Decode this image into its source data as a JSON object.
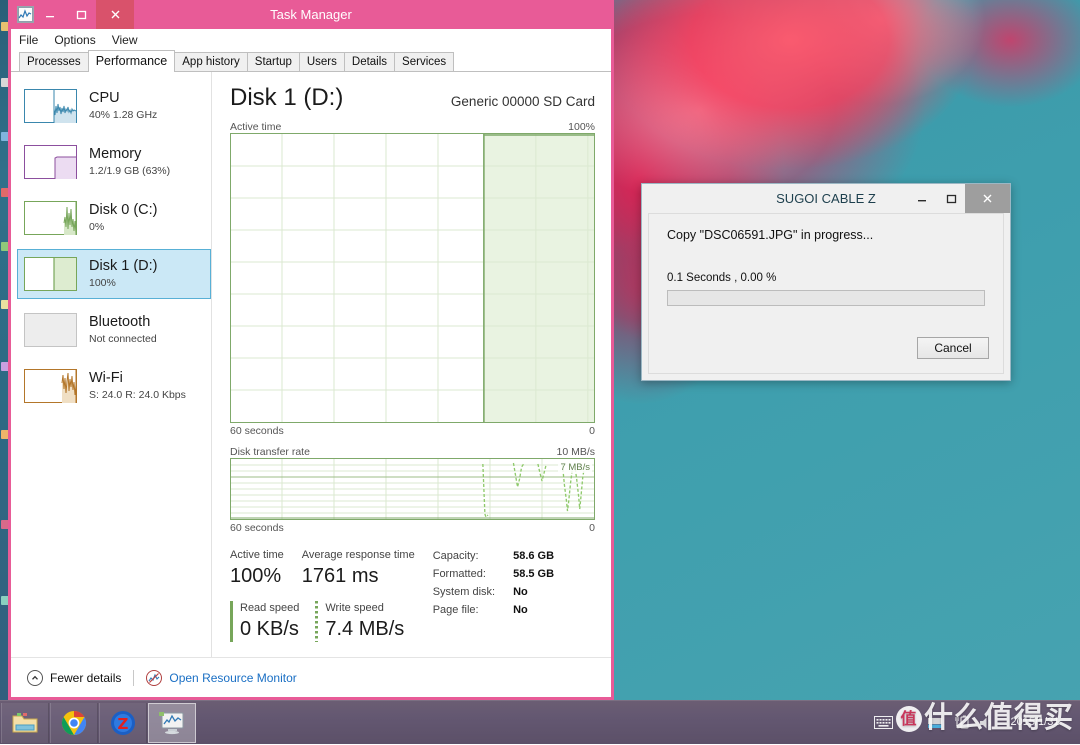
{
  "taskmanager": {
    "title": "Task Manager",
    "app_icon": "chart-icon",
    "window_buttons": {
      "minimize": "minimize-icon",
      "maximize": "maximize-icon",
      "close": "close-icon"
    },
    "menu": [
      "File",
      "Options",
      "View"
    ],
    "tabs": [
      {
        "label": "Processes",
        "active": false
      },
      {
        "label": "Performance",
        "active": true
      },
      {
        "label": "App history",
        "active": false
      },
      {
        "label": "Startup",
        "active": false
      },
      {
        "label": "Users",
        "active": false
      },
      {
        "label": "Details",
        "active": false
      },
      {
        "label": "Services",
        "active": false
      }
    ],
    "sidebar": {
      "items": [
        {
          "name": "CPU",
          "sub": "40%  1.28 GHz",
          "color": "#3a87ad",
          "selected": false
        },
        {
          "name": "Memory",
          "sub": "1.2/1.9 GB (63%)",
          "color": "#8c4f9e",
          "selected": false
        },
        {
          "name": "Disk 0 (C:)",
          "sub": "0%",
          "color": "#77a65a",
          "selected": false
        },
        {
          "name": "Disk 1 (D:)",
          "sub": "100%",
          "color": "#77a65a",
          "selected": true
        },
        {
          "name": "Bluetooth",
          "sub": "Not connected",
          "color": "#bdbdbd",
          "selected": false
        },
        {
          "name": "Wi-Fi",
          "sub": "S: 24.0 R: 24.0 Kbps",
          "color": "#b3762a",
          "selected": false
        }
      ]
    },
    "main": {
      "title": "Disk 1 (D:)",
      "device": "Generic 00000 SD Card",
      "active_graph": {
        "caption": "Active time",
        "max_label": "100%",
        "left_foot": "60 seconds",
        "right_foot": "0"
      },
      "rate_graph": {
        "caption": "Disk transfer rate",
        "max_label": "10 MB/s",
        "peak_label": "7 MB/s",
        "left_foot": "60 seconds",
        "right_foot": "0"
      },
      "stats": {
        "active_time_label": "Active time",
        "active_time_value": "100%",
        "avg_response_label": "Average response time",
        "avg_response_value": "1761 ms",
        "read_label": "Read speed",
        "read_value": "0 KB/s",
        "write_label": "Write speed",
        "write_value": "7.4 MB/s"
      },
      "properties": [
        {
          "key": "Capacity:",
          "value": "58.6 GB"
        },
        {
          "key": "Formatted:",
          "value": "58.5 GB"
        },
        {
          "key": "System disk:",
          "value": "No"
        },
        {
          "key": "Page file:",
          "value": "No"
        }
      ]
    },
    "footer": {
      "fewer_details": "Fewer details",
      "fewer_details_icon": "chevron-up-circle-icon",
      "resource_monitor": "Open Resource Monitor",
      "resource_monitor_icon": "resource-monitor-icon"
    },
    "accent_color": "#e85b97",
    "close_color": "#d9526b"
  },
  "sugoi_dialog": {
    "title": "SUGOI CABLE Z",
    "message": "Copy \"DSC06591.JPG\" in progress...",
    "status": "0.1 Seconds , 0.00 %",
    "progress_percent": 0,
    "cancel_label": "Cancel",
    "window_buttons": {
      "minimize": "minimize-icon",
      "maximize": "maximize-icon",
      "close": "close-icon"
    }
  },
  "taskbar": {
    "buttons": [
      {
        "name": "file-explorer",
        "active": false
      },
      {
        "name": "chrome",
        "active": false
      },
      {
        "name": "sugoi-cable-z",
        "active": false
      },
      {
        "name": "task-manager",
        "active": true
      }
    ],
    "tray_icons": [
      "keyboard-icon",
      "show-hidden-icons-chevron",
      "network-icon",
      "battery-icon",
      "volume-icon"
    ],
    "clock_date": "2015/1/31"
  },
  "watermark": {
    "badge": "值",
    "text": "什么值得买"
  }
}
